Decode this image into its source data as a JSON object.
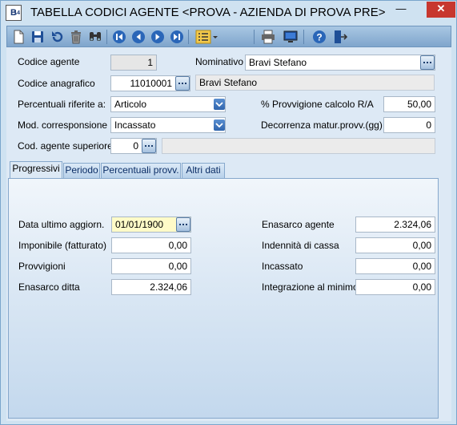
{
  "window": {
    "title": "TABELLA CODICI AGENTE <PROVA - AZIENDA DI PROVA PRE>",
    "icon_letter": "B",
    "icon_sub": "14",
    "min_glyph": "—",
    "close_glyph": "✕"
  },
  "toolbar": {
    "icons": [
      "new-document-icon",
      "save-icon",
      "undo-icon",
      "delete-icon",
      "search-icon",
      "first-record-icon",
      "previous-record-icon",
      "next-record-icon",
      "last-record-icon",
      "list-options-icon",
      "print-icon",
      "preview-icon",
      "help-icon",
      "exit-icon"
    ]
  },
  "header": {
    "codice_agente": {
      "label": "Codice agente",
      "value": "1"
    },
    "nominativo": {
      "label": "Nominativo",
      "value": "Bravi Stefano"
    },
    "codice_anagrafico": {
      "label": "Codice anagrafico",
      "value": "11010001",
      "description": "Bravi Stefano"
    },
    "percentuali_riferite": {
      "label": "Percentuali riferite a:",
      "value": "Articolo"
    },
    "provvigione_calcolo": {
      "label": "% Provvigione calcolo R/A",
      "value": "50,00"
    },
    "mod_corresponsione": {
      "label": "Mod. corresponsione",
      "value": "Incassato"
    },
    "decorrenza": {
      "label": "Decorrenza matur.provv.(gg)",
      "value": "0"
    },
    "agente_superiore": {
      "label": "Cod. agente superiore",
      "value": "0",
      "description": ""
    }
  },
  "tabs": [
    {
      "label": "Progressivi",
      "active": true
    },
    {
      "label": "Periodo",
      "active": false
    },
    {
      "label": "Percentuali provv.",
      "active": false
    },
    {
      "label": "Altri dati",
      "active": false
    }
  ],
  "progressivi": {
    "data_ultimo": {
      "label": "Data ultimo aggiorn.",
      "value": "01/01/1900"
    },
    "imponibile": {
      "label": "Imponibile (fatturato)",
      "value": "0,00"
    },
    "provvigioni": {
      "label": "Provvigioni",
      "value": "0,00"
    },
    "enasarco_ditta": {
      "label": "Enasarco ditta",
      "value": "2.324,06"
    },
    "enasarco_agente": {
      "label": "Enasarco agente",
      "value": "2.324,06"
    },
    "indennita_cassa": {
      "label": "Indennità di cassa",
      "value": "0,00"
    },
    "incassato": {
      "label": "Incassato",
      "value": "0,00"
    },
    "integrazione_minimo": {
      "label": "Integrazione al minimo",
      "value": "0,00"
    }
  }
}
